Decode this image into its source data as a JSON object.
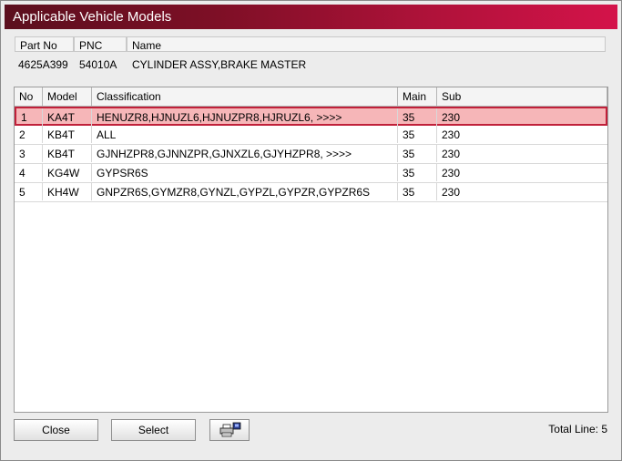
{
  "window": {
    "title": "Applicable Vehicle Models"
  },
  "part_header": {
    "columns": [
      "Part No",
      "PNC",
      "Name"
    ],
    "values": {
      "part_no": "4625A399",
      "pnc": "54010A",
      "name": "CYLINDER ASSY,BRAKE MASTER"
    }
  },
  "table": {
    "columns": [
      "No",
      "Model",
      "Classification",
      "Main",
      "Sub"
    ],
    "rows": [
      {
        "no": "1",
        "model": "KA4T",
        "classification": "HENUZR8,HJNUZL6,HJNUZPR8,HJRUZL6,  >>>>",
        "main": "35",
        "sub": "230",
        "selected": true
      },
      {
        "no": "2",
        "model": "KB4T",
        "classification": "ALL",
        "main": "35",
        "sub": "230",
        "selected": false
      },
      {
        "no": "3",
        "model": "KB4T",
        "classification": "GJNHZPR8,GJNNZPR,GJNXZL6,GJYHZPR8,  >>>>",
        "main": "35",
        "sub": "230",
        "selected": false
      },
      {
        "no": "4",
        "model": "KG4W",
        "classification": "GYPSR6S",
        "main": "35",
        "sub": "230",
        "selected": false
      },
      {
        "no": "5",
        "model": "KH4W",
        "classification": "GNPZR6S,GYMZR8,GYNZL,GYPZL,GYPZR,GYPZR6S",
        "main": "35",
        "sub": "230",
        "selected": false
      }
    ]
  },
  "footer": {
    "close_label": "Close",
    "select_label": "Select",
    "print_icon": "printer-icon",
    "total_text": "Total Line: 5"
  },
  "colors": {
    "title_dark": "#5b0f1e",
    "title_light": "#d4134a",
    "selection_fill": "#f6b6b8",
    "selection_border": "#c0203a"
  }
}
